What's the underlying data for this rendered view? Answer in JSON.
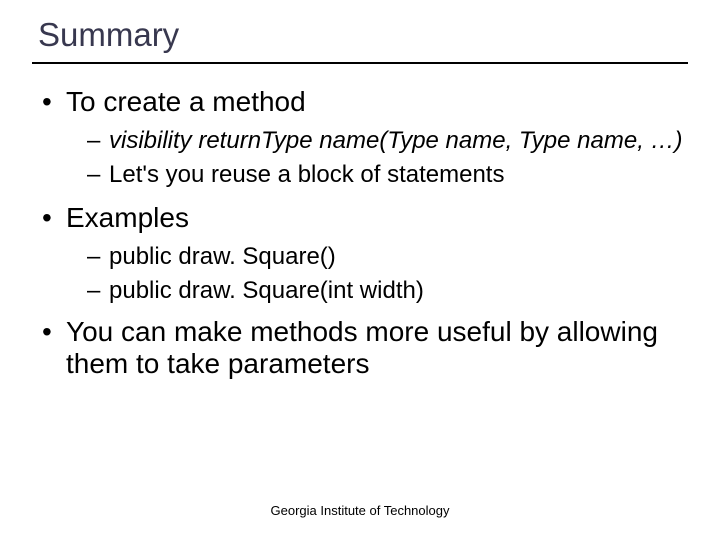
{
  "title": "Summary",
  "bullets": {
    "b1": "To create a method",
    "b1_1_prefix": "visibility returnType name(Type name, Type name, …)",
    "b1_2": "Let's you reuse a block of statements",
    "b2": "Examples",
    "b2_1": "public draw. Square()",
    "b2_2": "public draw. Square(int width)",
    "b3": "You can make methods more useful by allowing them to take parameters"
  },
  "footer": "Georgia Institute of Technology"
}
